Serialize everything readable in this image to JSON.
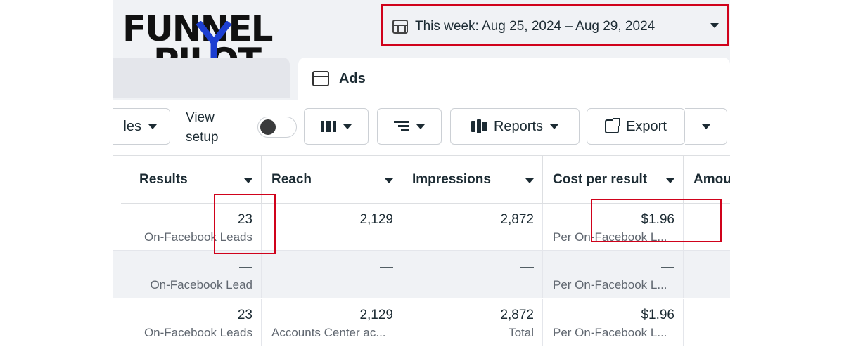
{
  "logo": {
    "line1": "FUNNEL",
    "line2": "PILOT"
  },
  "date_picker": {
    "label": "This week: Aug 25, 2024 – Aug 29, 2024",
    "icon": "calendar-icon"
  },
  "tabs": {
    "ads_label": "Ads",
    "ads_icon": "ads-window-icon"
  },
  "toolbar": {
    "partial_label": "les",
    "view_setup_line1": "View",
    "view_setup_line2": "setup",
    "reports_label": "Reports",
    "export_label": "Export"
  },
  "table": {
    "columns": [
      "Results",
      "Reach",
      "Impressions",
      "Cost per result",
      "Amou"
    ],
    "rows": [
      {
        "results": "23",
        "results_sub": "On-Facebook Leads",
        "reach": "2,129",
        "reach_sub": "",
        "impressions": "2,872",
        "impressions_sub": "",
        "cpr": "$1.96",
        "cpr_sub": "Per On-Facebook L..."
      },
      {
        "results": "—",
        "results_sub": "On-Facebook Lead",
        "reach": "—",
        "reach_sub": "",
        "impressions": "—",
        "impressions_sub": "",
        "cpr": "—",
        "cpr_sub": "Per On-Facebook L..."
      },
      {
        "results": "23",
        "results_sub": "On-Facebook Leads",
        "reach": "2,129",
        "reach_sub": "Accounts Center ac...",
        "impressions": "2,872",
        "impressions_sub": "Total",
        "cpr": "$1.96",
        "cpr_sub": "Per On-Facebook L..."
      }
    ]
  },
  "colors": {
    "highlight": "#d0021b",
    "logo_accent": "#1d3fd1"
  }
}
